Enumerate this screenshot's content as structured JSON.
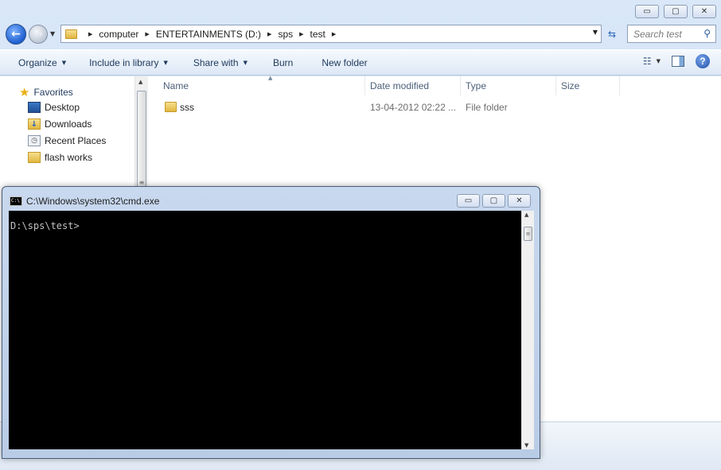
{
  "explorer": {
    "window_controls": {
      "minimize": "▭",
      "maximize": "▢",
      "close": "✕"
    },
    "nav": {
      "back": "←",
      "forward": "→",
      "recent": "▼"
    },
    "address": {
      "crumbs": [
        "computer",
        "ENTERTAINMENTS (D:)",
        "sps",
        "test"
      ],
      "separator": "▶",
      "dropdown": "▼"
    },
    "refresh": "⇆",
    "search": {
      "placeholder": "Search test",
      "icon": "magnifier-icon",
      "glyph": "⚲"
    },
    "toolbar": {
      "organize": "Organize",
      "include_in_library": "Include in library",
      "share_with": "Share with",
      "burn": "Burn",
      "new_folder": "New folder",
      "dropdown": "▼",
      "views_glyph": "☷",
      "help_glyph": "?"
    },
    "nav_pane": {
      "favorites": "Favorites",
      "star": "★",
      "items": [
        {
          "label": "Desktop",
          "icon": "desktop-icon"
        },
        {
          "label": "Downloads",
          "icon": "downloads-icon",
          "glyph": "↓"
        },
        {
          "label": "Recent Places",
          "icon": "recent-places-icon",
          "glyph": "◷"
        },
        {
          "label": "flash works",
          "icon": "folder-icon"
        }
      ],
      "scroll_up": "▲",
      "scroll_grip": "≡"
    },
    "file_list": {
      "columns": [
        "Name",
        "Date modified",
        "Type",
        "Size"
      ],
      "sort_arrow": "▲",
      "rows": [
        {
          "name": "sss",
          "date_modified": "13-04-2012 02:22 ...",
          "type": "File folder",
          "size": ""
        }
      ]
    }
  },
  "cmd": {
    "icon_text": "C:\\",
    "title": "C:\\Windows\\system32\\cmd.exe",
    "window_controls": {
      "minimize": "▭",
      "maximize": "▢",
      "close": "✕"
    },
    "prompt": "D:\\sps\\test>",
    "scroll_up": "▲",
    "scroll_down": "▼",
    "scroll_grip": "≡"
  }
}
